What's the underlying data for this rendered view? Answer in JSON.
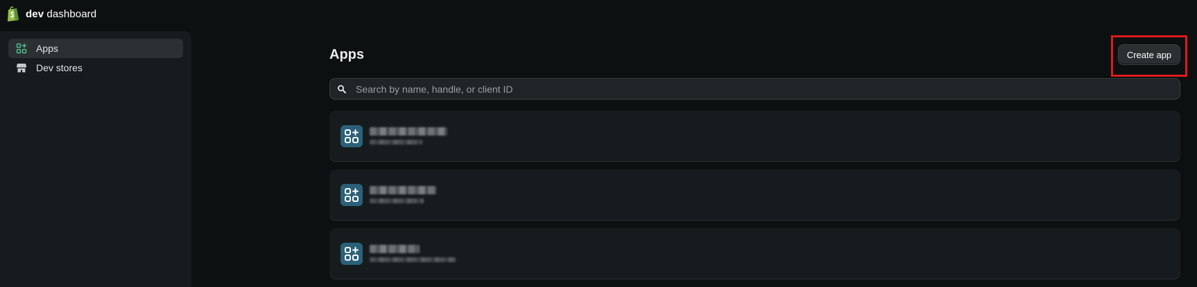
{
  "header": {
    "brand_strong": "dev",
    "brand_rest": " dashboard",
    "logo_icon": "shopify-bag-icon"
  },
  "sidebar": {
    "items": [
      {
        "label": "Apps",
        "icon": "apps-grid-icon",
        "active": true
      },
      {
        "label": "Dev stores",
        "icon": "store-icon",
        "active": false
      }
    ]
  },
  "main": {
    "title": "Apps",
    "create_button_label": "Create app",
    "search_placeholder": "Search by name, handle, or client ID"
  },
  "apps": [
    {
      "name": "",
      "handle": "",
      "redacted": true,
      "icon": "app-grid-plus-icon"
    },
    {
      "name": "",
      "handle": "",
      "redacted": true,
      "icon": "app-grid-plus-icon"
    },
    {
      "name": "",
      "handle": "",
      "redacted": true,
      "icon": "app-grid-plus-icon"
    }
  ],
  "colors": {
    "accent_highlight": "#e01a1a",
    "app_icon_bg": "#2b6079",
    "logo_green": "#95bf47"
  }
}
